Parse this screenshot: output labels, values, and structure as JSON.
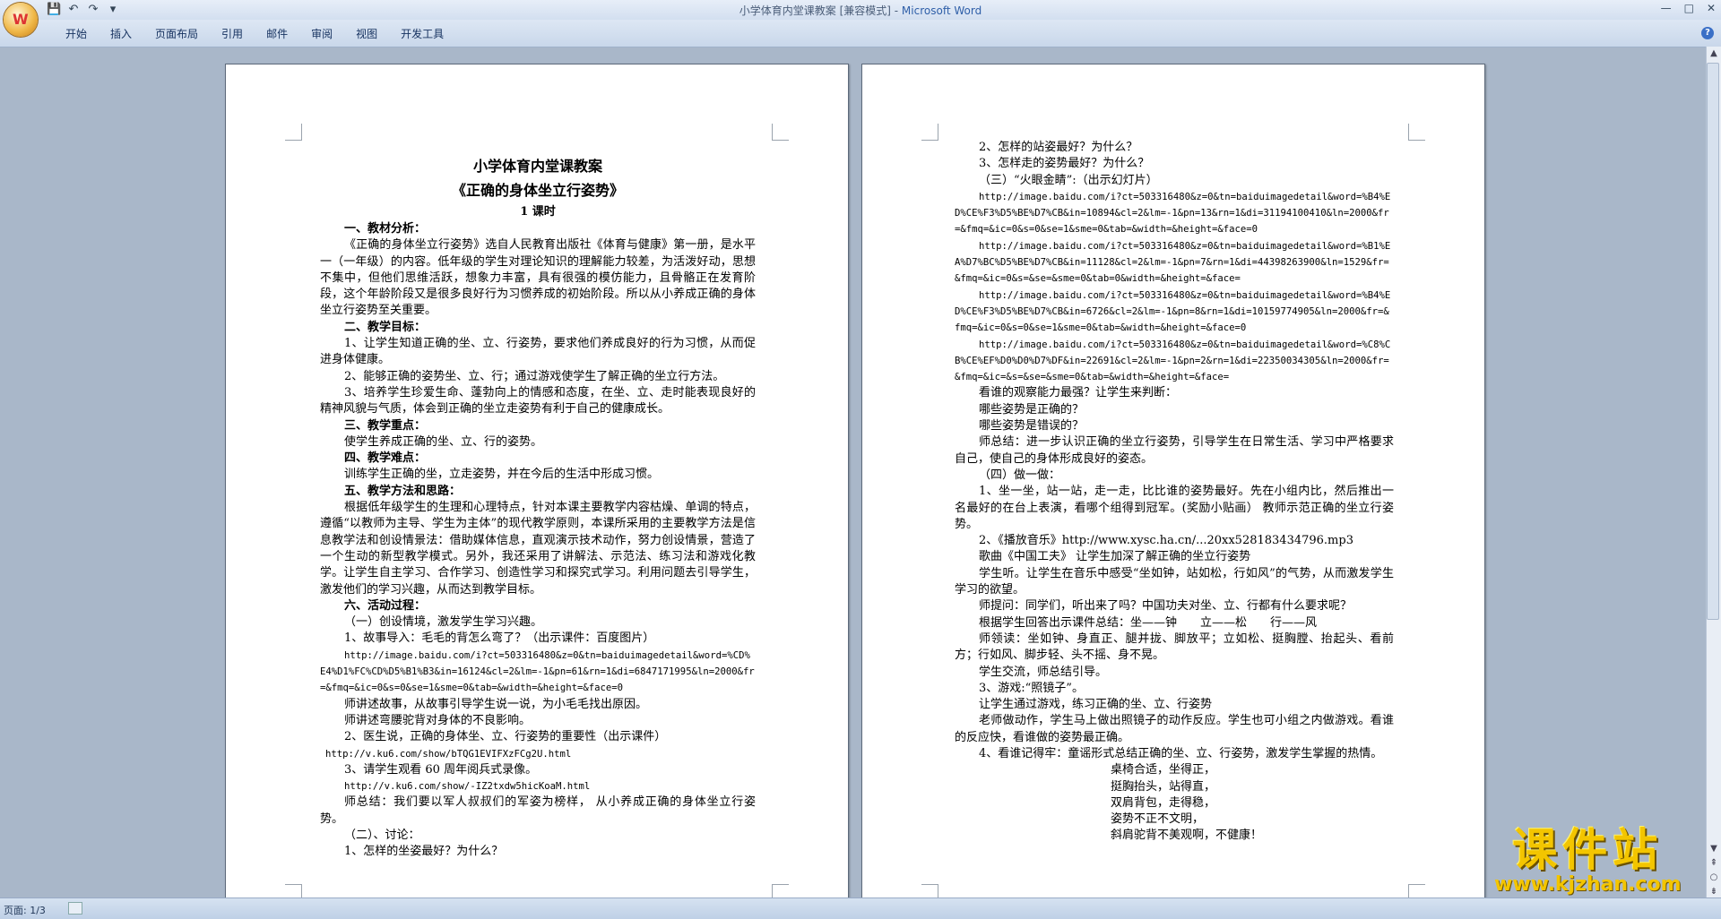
{
  "window": {
    "title": "小学体育内堂课教案 [兼容模式] - ",
    "app": "Microsoft Word"
  },
  "ribbon": {
    "tabs": [
      "开始",
      "插入",
      "页面布局",
      "引用",
      "邮件",
      "审阅",
      "视图",
      "开发工具"
    ]
  },
  "status": {
    "page": "页面: 1/3"
  },
  "watermark": {
    "cn": "课件站",
    "url": "www.kjzhan.com"
  },
  "page1": {
    "title": "小学体育内堂课教案",
    "subtitle": "《正确的身体坐立行姿势》",
    "hours": "1 课时",
    "h1": "一、教材分析：",
    "p1": "《正确的身体坐立行姿势》选自人民教育出版社《体育与健康》第一册，是水平一（一年级）的内容。低年级的学生对理论知识的理解能力较差，为活泼好动，思想不集中，但他们思维活跃，想象力丰富，具有很强的模仿能力，且骨骼正在发育阶段，这个年龄阶段又是很多良好行为习惯养成的初始阶段。所以从小养成正确的身体坐立行姿势至关重要。",
    "h2": "二、教学目标：",
    "p2a": "1、让学生知道正确的坐、立、行姿势，要求他们养成良好的行为习惯，从而促进身体健康。",
    "p2b": "2、能够正确的姿势坐、立、行；通过游戏使学生了解正确的坐立行方法。",
    "p2c": "3、培养学生珍爱生命、蓬勃向上的情感和态度，在坐、立、走时能表现良好的精神风貌与气质，体会到正确的坐立走姿势有利于自己的健康成长。",
    "h3": "三、教学重点：",
    "p3": "使学生养成正确的坐、立、行的姿势。",
    "h4": "四、教学难点：",
    "p4": "训练学生正确的坐，立走姿势，并在今后的生活中形成习惯。",
    "h5": "五、教学方法和思路：",
    "p5": "根据低年级学生的生理和心理特点，针对本课主要教学内容枯燥、单调的特点，遵循“以教师为主导、学生为主体”的现代教学原则，本课所采用的主要教学方法是信息教学法和创设情景法：借助媒体信息，直观演示技术动作，努力创设情景，营造了一个生动的新型教学模式。另外，我还采用了讲解法、示范法、练习法和游戏化教学。让学生自主学习、合作学习、创造性学习和探究式学习。利用问题去引导学生，激发他们的学习兴趣，从而达到教学目标。",
    "h6": "六、活动过程：",
    "p6a": "（一）创设情境，激发学生学习兴趣。",
    "p6b": "1、故事导入：毛毛的背怎么弯了？（出示课件：百度图片）",
    "url1": "http://image.baidu.com/i?ct=503316480&z=0&tn=baiduimagedetail&word=%CD%E4%D1%FC%CD%D5%B1%B3&in=16124&cl=2&lm=-1&pn=61&rn=1&di=6847171995&ln=2000&fr=&fmq=&ic=0&s=0&se=1&sme=0&tab=&width=&height=&face=0",
    "p6c": "师讲述故事，从故事引导学生说一说，为小毛毛找出原因。",
    "p6d": "师讲述弯腰驼背对身体的不良影响。",
    "p6e": "2、医生说，正确的身体坐、立、行姿势的重要性（出示课件）",
    "url2": "http://v.ku6.com/show/bTQG1EVIFXzFCg2U.html",
    "p6f": "3、请学生观看 60 周年阅兵式录像。",
    "url3": "http://v.ku6.com/show/-IZ2txdw5hicKoaM.html",
    "p6g": "师总结：我们要以军人叔叔们的军姿为榜样， 从小养成正确的身体坐立行姿势。",
    "p6h": "（二）、讨论：",
    "p6i": "1、怎样的坐姿最好？为什么？"
  },
  "page2": {
    "q2": "2、怎样的站姿最好？为什么？",
    "q3": "3、怎样走的姿势最好？为什么？",
    "s3": "（三）“火眼金睛”:（出示幻灯片）",
    "u1": "http://image.baidu.com/i?ct=503316480&z=0&tn=baiduimagedetail&word=%B4%ED%CE%F3%D5%BE%D7%CB&in=10894&cl=2&lm=-1&pn=13&rn=1&di=31194100410&ln=2000&fr=&fmq=&ic=0&s=0&se=1&sme=0&tab=&width=&height=&face=0",
    "u2": "http://image.baidu.com/i?ct=503316480&z=0&tn=baiduimagedetail&word=%B1%EA%D7%BC%D5%BE%D7%CB&in=11128&cl=2&lm=-1&pn=7&rn=1&di=44398263900&ln=1529&fr=&fmq=&ic=0&s=&se=&sme=0&tab=0&width=&height=&face=",
    "u3": "http://image.baidu.com/i?ct=503316480&z=0&tn=baiduimagedetail&word=%B4%ED%CE%F3%D5%BE%D7%CB&in=6726&cl=2&lm=-1&pn=8&rn=1&di=10159774905&ln=2000&fr=&fmq=&ic=0&s=0&se=1&sme=0&tab=&width=&height=&face=0",
    "u4": "http://image.baidu.com/i?ct=503316480&z=0&tn=baiduimagedetail&word=%C8%CB%CE%EF%D0%D0%D7%DF&in=22691&cl=2&lm=-1&pn=2&rn=1&di=22350034305&ln=2000&fr=&fmq=&ic=&s=&se=&sme=0&tab=&width=&height=&face=",
    "a1": "看谁的观察能力最强？让学生来判断：",
    "a2": "哪些姿势是正确的？",
    "a3": "哪些姿势是错误的？",
    "a4": "师总结：进一步认识正确的坐立行姿势，引导学生在日常生活、学习中严格要求自己，使自己的身体形成良好的姿态。",
    "s4": "（四）做一做：",
    "b1": "1、坐一坐，站一站，走一走，比比谁的姿势最好。先在小组内比，然后推出一名最好的在台上表演，看哪个组得到冠军。(奖励小贴画） 教师示范正确的坐立行姿势。",
    "b2": "2、《播放音乐》http://www.xysc.ha.cn/...20xx528183434796.mp3",
    "b3": "歌曲《中国工夫》 让学生加深了解正确的坐立行姿势",
    "b4": "学生听。让学生在音乐中感受“坐如钟，站如松，行如风”的气势，从而激发学生学习的欲望。",
    "b5": "师提问：同学们，听出来了吗？中国功夫对坐、立、行都有什么要求呢？",
    "b6": "根据学生回答出示课件总结：坐——钟　　立——松　　行——风",
    "b7": "师领读：坐如钟、身直正、腿并拢、脚放平；立如松、挺胸膛、抬起头、看前方；行如风、脚步轻、头不摇、身不晃。",
    "b8": "学生交流，师总结引导。",
    "b9": "3、游戏:“照镜子”。",
    "b10": "让学生通过游戏，练习正确的坐、立、行姿势",
    "b11": "老师做动作，学生马上做出照镜子的动作反应。学生也可小组之内做游戏。看谁的反应快，看谁做的姿势最正确。",
    "b12": "4、看谁记得牢：童谣形式总结正确的坐、立、行姿势，激发学生掌握的热情。",
    "poem": [
      "桌椅合适，坐得正，",
      "挺胸抬头，站得直，",
      "双肩背包，走得稳，",
      "姿势不正不文明，",
      "斜肩驼背不美观啊，不健康！"
    ]
  }
}
